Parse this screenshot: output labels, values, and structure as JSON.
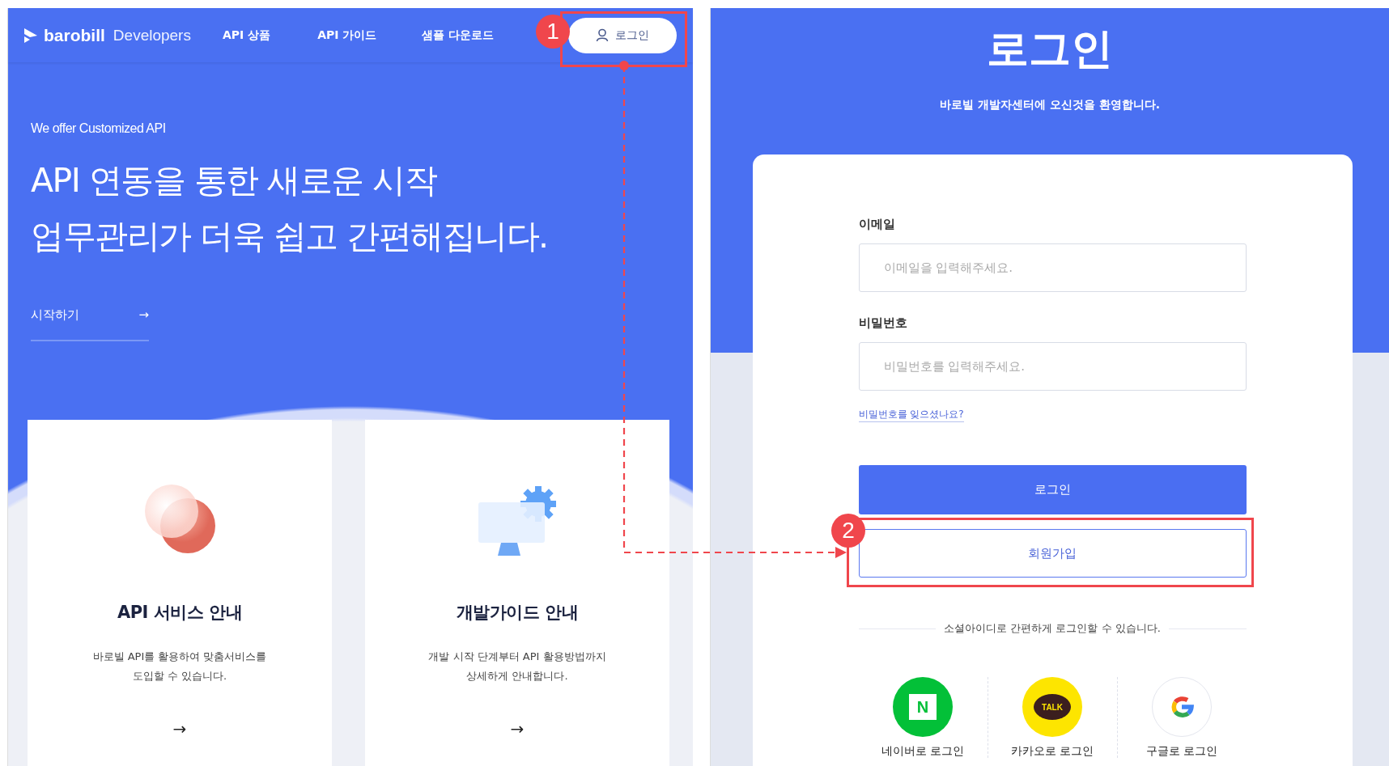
{
  "left_page": {
    "nav": {
      "brand": "barobill",
      "brand_sub": "Developers",
      "items": [
        "API 상품",
        "API 가이드",
        "샘플 다운로드"
      ],
      "login_button": "로그인"
    },
    "hero": {
      "eyebrow": "We offer Customized API",
      "headline_lines": [
        "API 연동을 통한 새로운 시작",
        "업무관리가 더욱 쉽고 간편해집니다."
      ],
      "cta": "시작하기",
      "cta_arrow": "→"
    },
    "cards": [
      {
        "kind": "circles",
        "title": "API 서비스 안내",
        "description_lines": [
          "바로빌 API를 활용하여 맞춤서비스를",
          "도입할 수 있습니다."
        ],
        "arrow": "→"
      },
      {
        "kind": "monitor",
        "title": "개발가이드 안내",
        "description_lines": [
          "개발 시작 단계부터 API 활용방법까지",
          "상세하게 안내합니다."
        ],
        "arrow": "→"
      }
    ]
  },
  "right_page": {
    "title": "로그인",
    "subtitle": "바로빌 개발자센터에 오신것을 환영합니다.",
    "form": {
      "fields": [
        {
          "label": "이메일",
          "placeholder": "이메일을 입력해주세요."
        },
        {
          "label": "비밀번호",
          "placeholder": "비밀번호를 입력해주세요."
        }
      ],
      "forgot_link": "비밀번호를 잊으셨나요?",
      "login_button": "로그인",
      "signup_button": "회원가입"
    },
    "social": {
      "caption": "소셜아이디로 간편하게 로그인할 수 있습니다.",
      "providers": [
        {
          "kind": "naver",
          "mark": "N",
          "label": "네이버로 로그인"
        },
        {
          "kind": "kakao",
          "mark": "TALK",
          "label": "카카오로 로그인"
        },
        {
          "kind": "google",
          "label": "구글로 로그인"
        }
      ]
    }
  },
  "annotations": [
    {
      "number": "1",
      "kind": "nav-login"
    },
    {
      "number": "2",
      "kind": "signup"
    }
  ]
}
